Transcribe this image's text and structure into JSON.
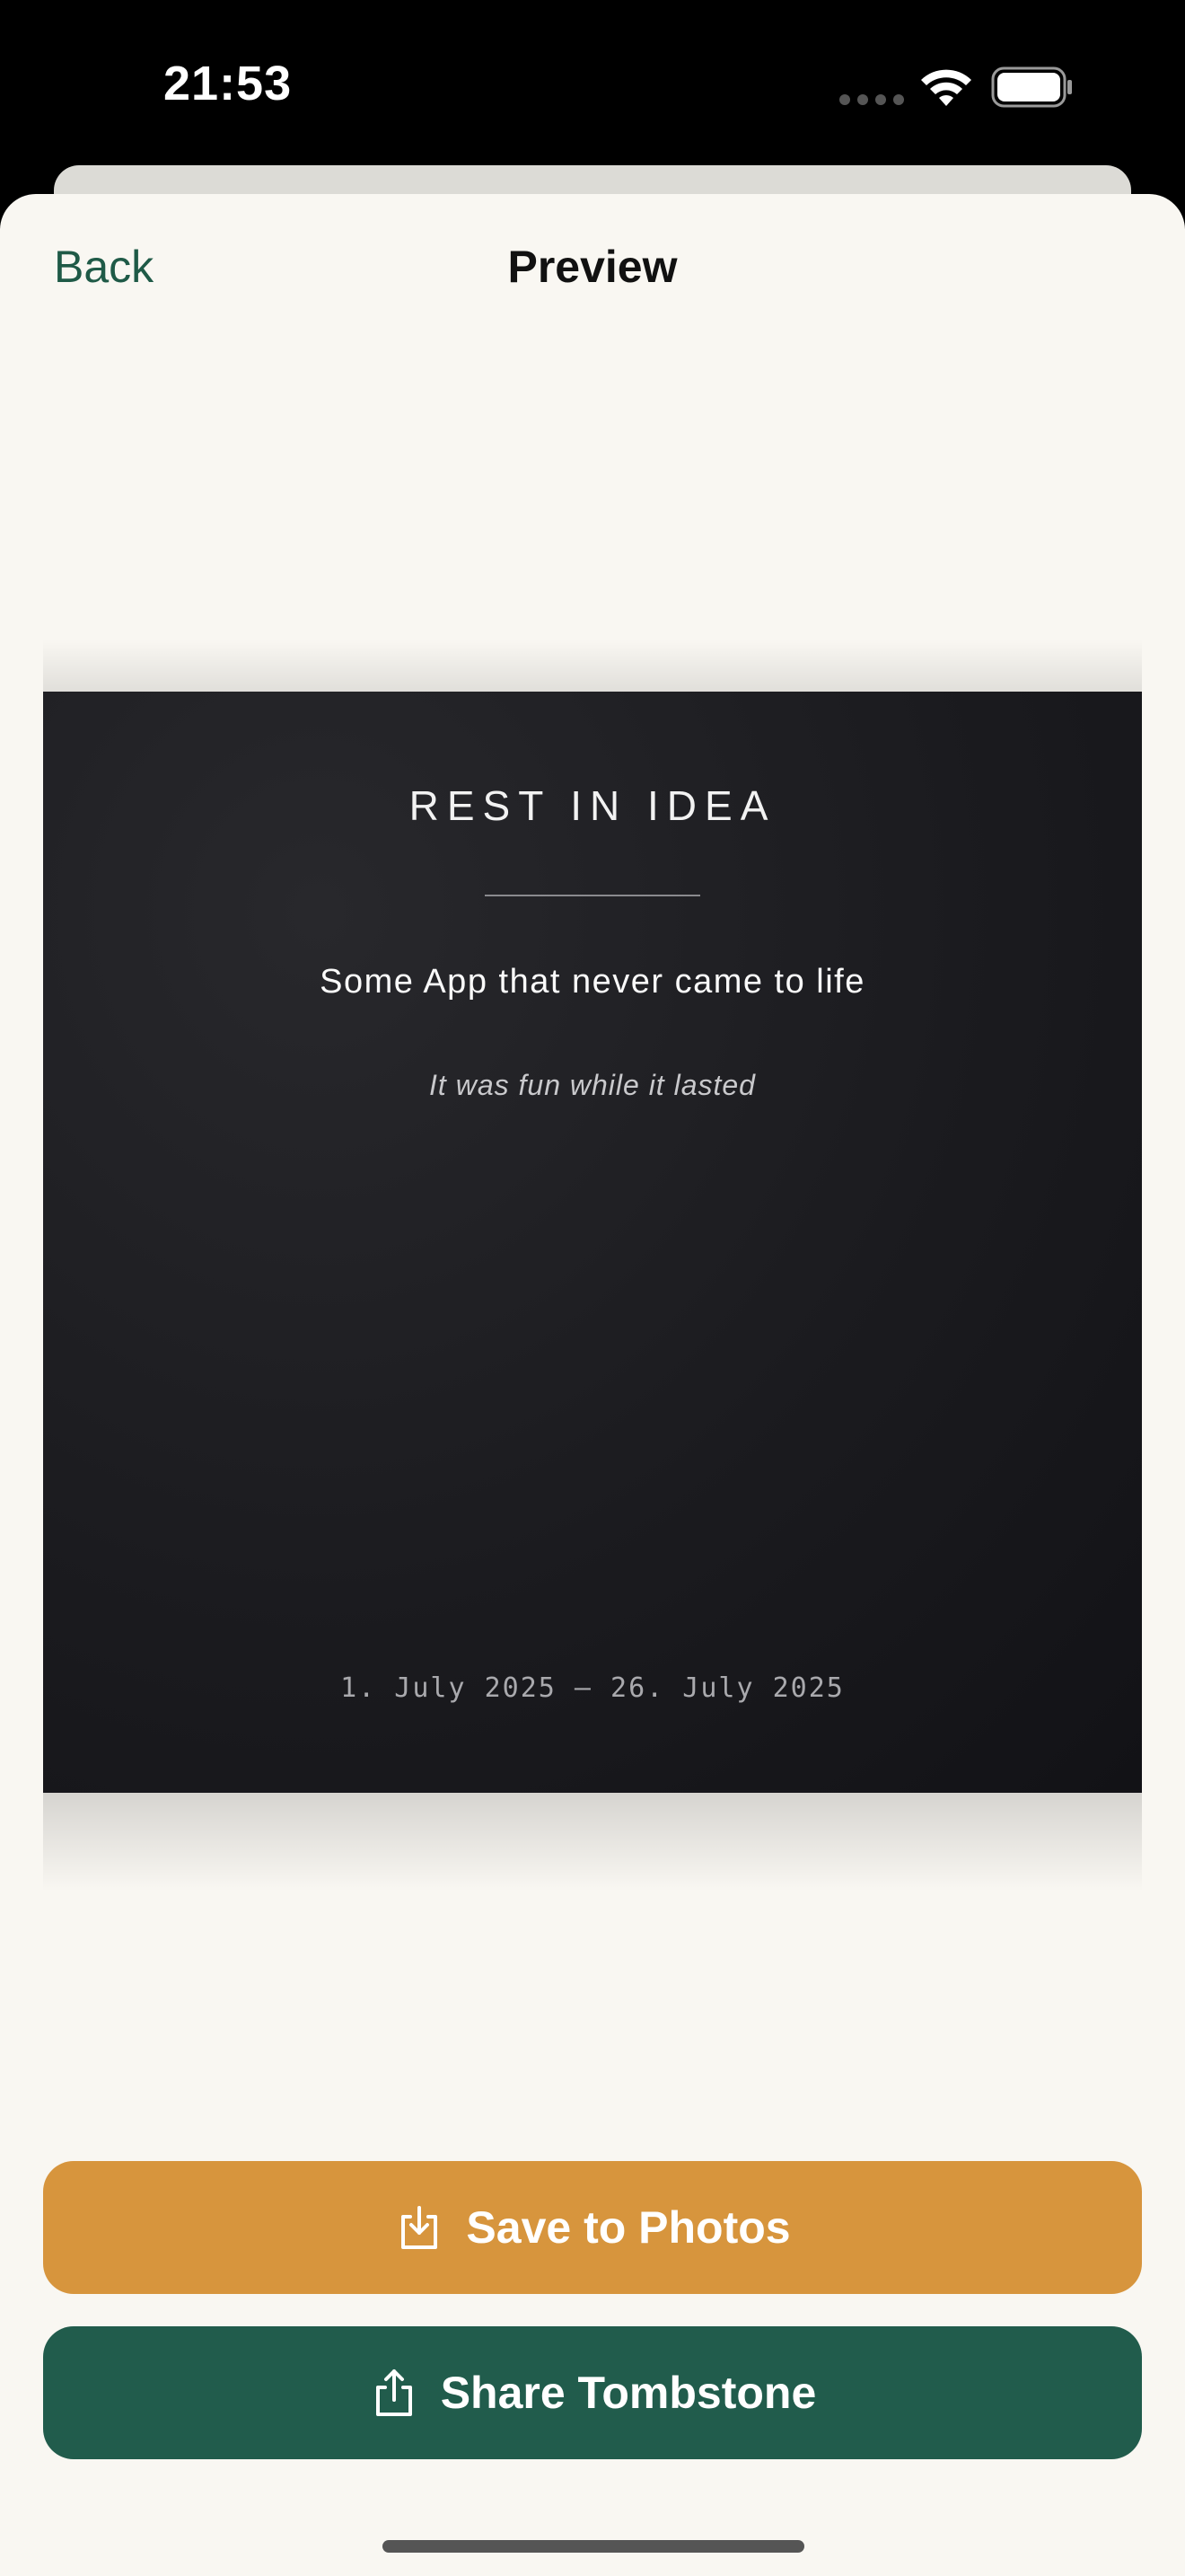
{
  "status_bar": {
    "time": "21:53",
    "icons": [
      "cellular-signal-icon",
      "wifi-icon",
      "battery-icon"
    ]
  },
  "nav": {
    "back_label": "Back",
    "title": "Preview"
  },
  "tombstone": {
    "heading": "REST IN IDEA",
    "name": "Some App that never came to life",
    "epitaph": "It was fun while it lasted",
    "dates": "1. July 2025 — 26. July 2025",
    "background_color": "#1b1b1f"
  },
  "actions": {
    "save_label": "Save to Photos",
    "save_icon": "save-to-photos-icon",
    "share_label": "Share Tombstone",
    "share_icon": "share-icon"
  },
  "colors": {
    "accent_green": "#1f5a47",
    "save_button": "#d7953d",
    "share_button": "#215c4c",
    "sheet_background": "#f9f7f2"
  }
}
